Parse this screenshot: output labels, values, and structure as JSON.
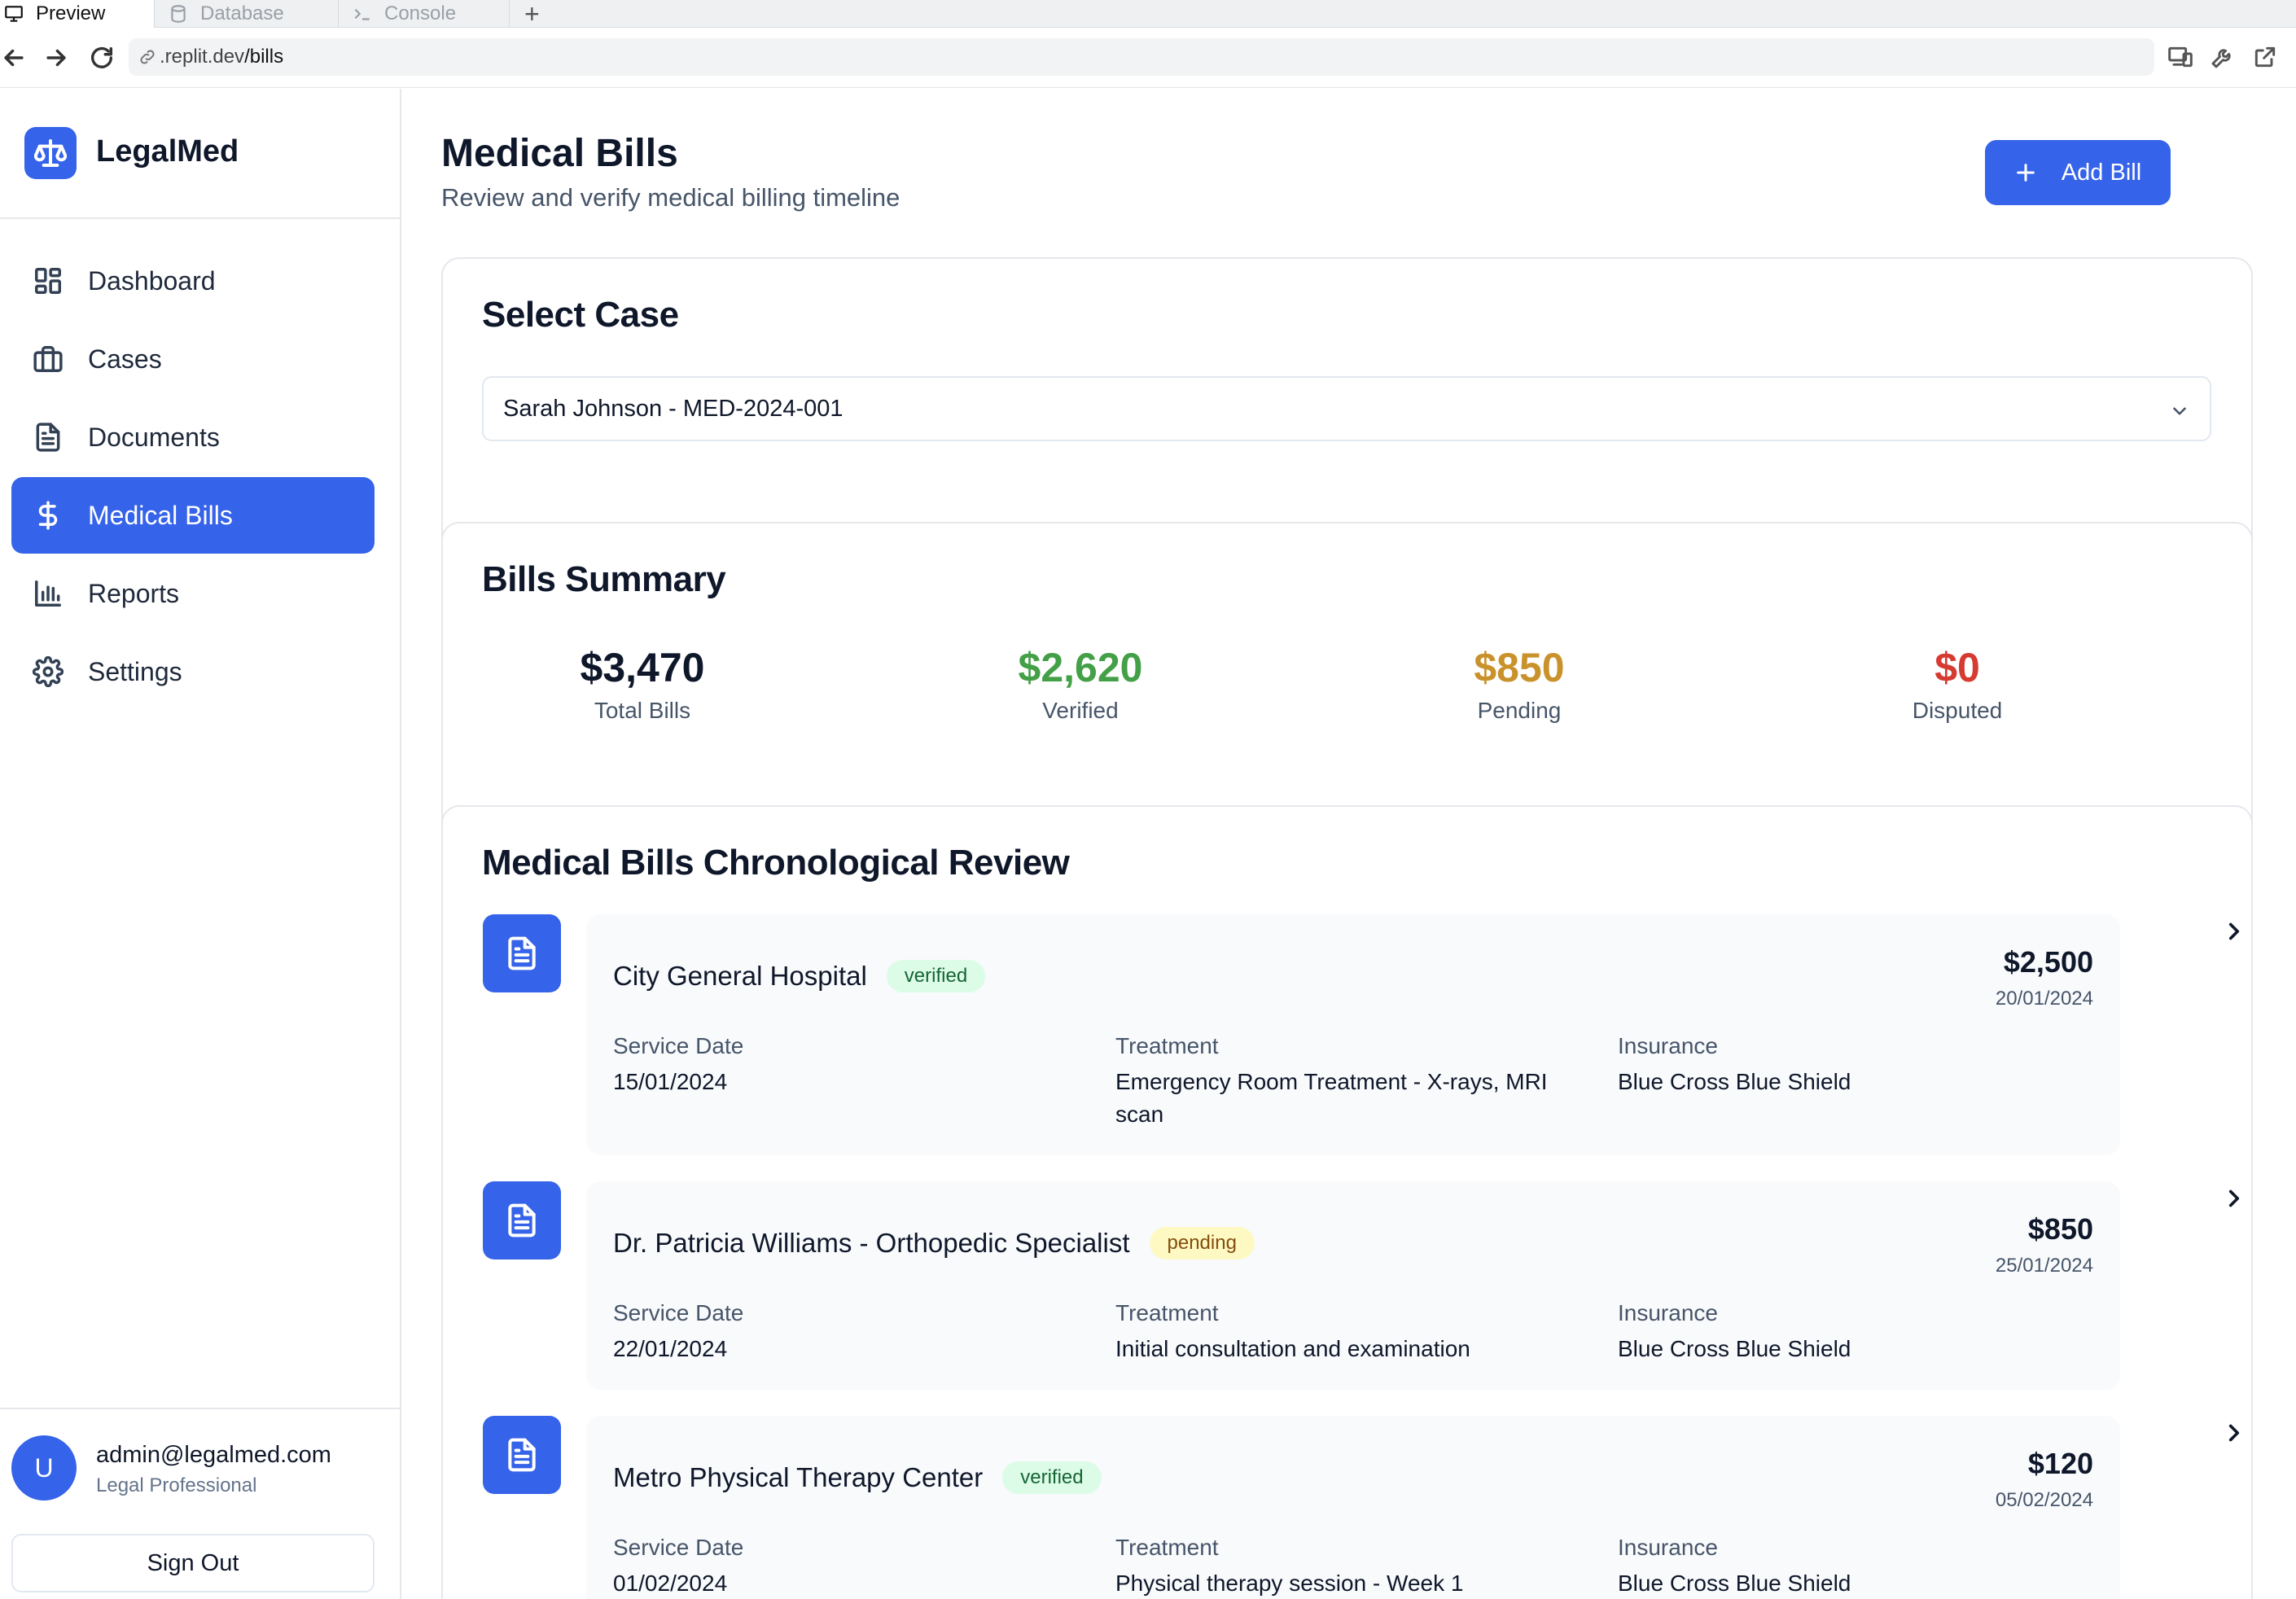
{
  "browser": {
    "tabs": [
      {
        "label": "Preview",
        "icon": "monitor-icon",
        "active": true
      },
      {
        "label": "Database",
        "icon": "database-icon",
        "active": false
      },
      {
        "label": "Console",
        "icon": "terminal-icon",
        "active": false
      }
    ],
    "new_tab": "+",
    "url_host": ".replit.dev",
    "url_path": "/bills"
  },
  "sidebar": {
    "brand": "LegalMed",
    "items": [
      {
        "label": "Dashboard",
        "icon": "grid-icon"
      },
      {
        "label": "Cases",
        "icon": "briefcase-icon"
      },
      {
        "label": "Documents",
        "icon": "document-icon"
      },
      {
        "label": "Medical Bills",
        "icon": "dollar-icon",
        "active": true
      },
      {
        "label": "Reports",
        "icon": "bar-chart-icon"
      },
      {
        "label": "Settings",
        "icon": "gear-icon"
      }
    ],
    "user": {
      "initial": "U",
      "email": "admin@legalmed.com",
      "role": "Legal Professional"
    },
    "sign_out": "Sign Out"
  },
  "header": {
    "title": "Medical Bills",
    "subtitle": "Review and verify medical billing timeline",
    "add_button": "Add Bill"
  },
  "select_case": {
    "title": "Select Case",
    "selected": "Sarah Johnson - MED-2024-001"
  },
  "summary": {
    "title": "Bills Summary",
    "stats": [
      {
        "value": "$3,470",
        "label": "Total Bills",
        "color": "#0f172a"
      },
      {
        "value": "$2,620",
        "label": "Verified",
        "color": "#43a047"
      },
      {
        "value": "$850",
        "label": "Pending",
        "color": "#c9922b"
      },
      {
        "value": "$0",
        "label": "Disputed",
        "color": "#d63a31"
      }
    ]
  },
  "review": {
    "title": "Medical Bills Chronological Review",
    "field_labels": {
      "service_date": "Service Date",
      "treatment": "Treatment",
      "insurance": "Insurance"
    },
    "bills": [
      {
        "provider": "City General Hospital",
        "status": "verified",
        "amount": "$2,500",
        "date": "20/01/2024",
        "service_date": "15/01/2024",
        "treatment": "Emergency Room Treatment - X-rays, MRI scan",
        "insurance": "Blue Cross Blue Shield"
      },
      {
        "provider": "Dr. Patricia Williams - Orthopedic Specialist",
        "status": "pending",
        "amount": "$850",
        "date": "25/01/2024",
        "service_date": "22/01/2024",
        "treatment": "Initial consultation and examination",
        "insurance": "Blue Cross Blue Shield"
      },
      {
        "provider": "Metro Physical Therapy Center",
        "status": "verified",
        "amount": "$120",
        "date": "05/02/2024",
        "service_date": "01/02/2024",
        "treatment": "Physical therapy session - Week 1",
        "insurance": "Blue Cross Blue Shield"
      }
    ]
  }
}
